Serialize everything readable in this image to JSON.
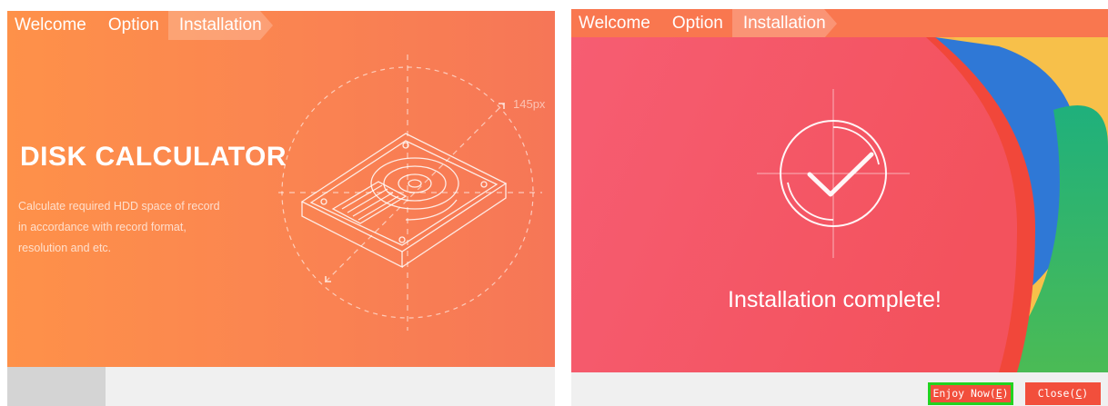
{
  "left": {
    "nav": {
      "welcome": "Welcome",
      "option": "Option",
      "installation": "Installation"
    },
    "hero": {
      "title": "DISK CALCULATOR",
      "description_line1": "Calculate required HDD space of record",
      "description_line2": "in accordance with record format,",
      "description_line3": "resolution and etc.",
      "dimension_label": "145px"
    }
  },
  "right": {
    "nav": {
      "welcome": "Welcome",
      "option": "Option",
      "installation": "Installation"
    },
    "status_text": "Installation complete!",
    "buttons": {
      "enjoy_prefix": "Enjoy Now(",
      "enjoy_key": "E",
      "enjoy_suffix": ")",
      "close_prefix": "Close(",
      "close_key": "C",
      "close_suffix": ")"
    }
  },
  "colors": {
    "accent_orange": "#fe9149",
    "accent_red": "#f24f3c",
    "focus_green": "#22d31f"
  },
  "icons": {
    "hero_art": "hard-disk-icon",
    "status_icon": "checkmark-icon"
  }
}
